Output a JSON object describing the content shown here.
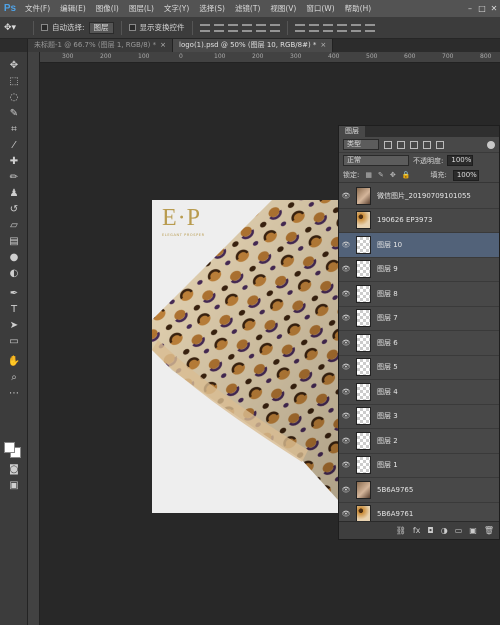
{
  "app": {
    "logo": "Ps"
  },
  "menu": [
    "文件(F)",
    "编辑(E)",
    "图像(I)",
    "图层(L)",
    "文字(Y)",
    "选择(S)",
    "滤镜(T)",
    "视图(V)",
    "窗口(W)",
    "帮助(H)"
  ],
  "options": {
    "auto_select_label": "自动选择:",
    "auto_select_value": "图层",
    "show_transform_label": "显示变换控件"
  },
  "tabs": [
    {
      "label": "未标题-1 @ 66.7% (图层 1, RGB/8) *",
      "active": false
    },
    {
      "label": "logo(1).psd @ 50% (图层 10, RGB/8#) *",
      "active": true
    }
  ],
  "rulers": {
    "h": [
      "300",
      "200",
      "100",
      "0",
      "100",
      "200",
      "300",
      "400",
      "500",
      "600",
      "700",
      "800"
    ]
  },
  "document": {
    "logo_text": "E·P",
    "logo_subtext": "ELEGANT PROSPER"
  },
  "layers_panel": {
    "title": "图层",
    "filter_kind": "类型",
    "blend_mode": "正常",
    "opacity_label": "不透明度:",
    "opacity_value": "100%",
    "lock_label": "锁定:",
    "fill_label": "填充:",
    "fill_value": "100%",
    "layers": [
      {
        "name": "微信图片_20190709101055",
        "thumb": "photo",
        "visible": true,
        "selected": false
      },
      {
        "name": "190626 EP3973",
        "thumb": "leopard",
        "visible": false,
        "selected": false
      },
      {
        "name": "图层 10",
        "thumb": "transparent",
        "visible": true,
        "selected": true
      },
      {
        "name": "图层 9",
        "thumb": "transparent",
        "visible": true,
        "selected": false
      },
      {
        "name": "图层 8",
        "thumb": "transparent",
        "visible": true,
        "selected": false
      },
      {
        "name": "图层 7",
        "thumb": "transparent",
        "visible": true,
        "selected": false
      },
      {
        "name": "图层 6",
        "thumb": "transparent",
        "visible": true,
        "selected": false
      },
      {
        "name": "图层 5",
        "thumb": "transparent",
        "visible": true,
        "selected": false
      },
      {
        "name": "图层 4",
        "thumb": "transparent",
        "visible": true,
        "selected": false
      },
      {
        "name": "图层 3",
        "thumb": "transparent",
        "visible": true,
        "selected": false
      },
      {
        "name": "图层 2",
        "thumb": "transparent",
        "visible": true,
        "selected": false
      },
      {
        "name": "图层 1",
        "thumb": "transparent",
        "visible": true,
        "selected": false
      },
      {
        "name": "5B6A9765",
        "thumb": "photo",
        "visible": true,
        "selected": false
      },
      {
        "name": "5B6A9761",
        "thumb": "leopard",
        "visible": true,
        "selected": false
      }
    ]
  },
  "colors": {
    "accent": "#4fa3e8",
    "selected_layer": "#526279",
    "logo_gold": "#b89b4e"
  }
}
